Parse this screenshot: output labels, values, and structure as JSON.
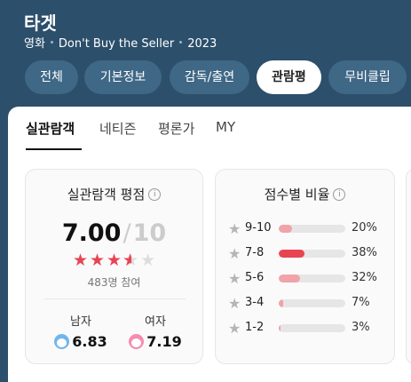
{
  "header": {
    "title": "타겟",
    "meta": [
      "영화",
      "Don't Buy the Seller",
      "2023"
    ]
  },
  "tabs": [
    {
      "label": "전체",
      "active": false
    },
    {
      "label": "기본정보",
      "active": false
    },
    {
      "label": "감독/출연",
      "active": false
    },
    {
      "label": "관람평",
      "active": true
    },
    {
      "label": "무비클립",
      "active": false
    }
  ],
  "subtabs": [
    {
      "label": "실관람객",
      "active": true
    },
    {
      "label": "네티즌",
      "active": false
    },
    {
      "label": "평론가",
      "active": false
    },
    {
      "label": "MY",
      "active": false
    }
  ],
  "rating_card": {
    "title": "실관람객 평점",
    "info_icon": "i",
    "score": "7.00",
    "slash": "/",
    "max": "10",
    "stars_value": 3.5,
    "stars_total": 5,
    "participants": "483명 참여",
    "male": {
      "label": "남자",
      "score": "6.83"
    },
    "female": {
      "label": "여자",
      "score": "7.19"
    }
  },
  "distribution_card": {
    "title": "점수별 비율",
    "info_icon": "i",
    "rows": [
      {
        "label": "9-10",
        "percent": 20,
        "percent_text": "20%",
        "color": "#f0a3a8"
      },
      {
        "label": "7-8",
        "percent": 38,
        "percent_text": "38%",
        "color": "#e94352"
      },
      {
        "label": "5-6",
        "percent": 32,
        "percent_text": "32%",
        "color": "#f0a3a8"
      },
      {
        "label": "3-4",
        "percent": 7,
        "percent_text": "7%",
        "color": "#f0a3a8"
      },
      {
        "label": "1-2",
        "percent": 3,
        "percent_text": "3%",
        "color": "#f0a3a8"
      }
    ]
  },
  "colors": {
    "header_bg": "#2c4f6b",
    "tab_bg": "#3f6786",
    "star_red": "#e94352",
    "bar_light": "#f0a3a8"
  }
}
